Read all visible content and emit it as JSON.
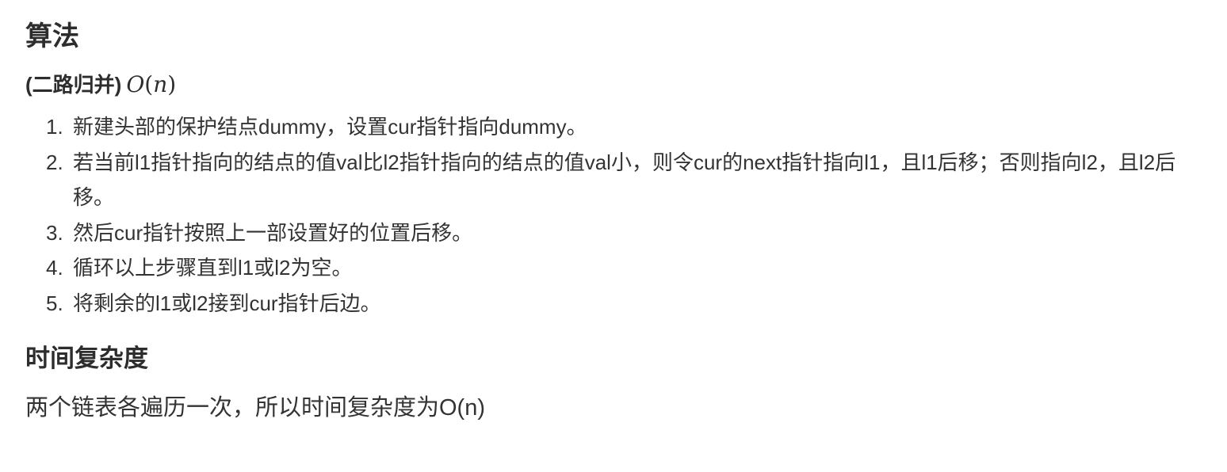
{
  "algorithm_heading": "算法",
  "method": {
    "title": "(二路归并)",
    "complexity_fn": "O",
    "complexity_open": "(",
    "complexity_var": "n",
    "complexity_close": ")"
  },
  "steps": [
    {
      "num": "1.",
      "text": "新建头部的保护结点dummy，设置cur指针指向dummy。"
    },
    {
      "num": "2.",
      "text": "若当前l1指针指向的结点的值val比l2指针指向的结点的值val小，则令cur的next指针指向l1，且l1后移；否则指向l2，且l2后移。"
    },
    {
      "num": "3.",
      "text": "然后cur指针按照上一部设置好的位置后移。"
    },
    {
      "num": "4.",
      "text": "循环以上步骤直到l1或l2为空。"
    },
    {
      "num": "5.",
      "text": "将剩余的l1或l2接到cur指针后边。"
    }
  ],
  "time_complexity_heading": "时间复杂度",
  "time_complexity_text": "两个链表各遍历一次，所以时间复杂度为O(n)"
}
